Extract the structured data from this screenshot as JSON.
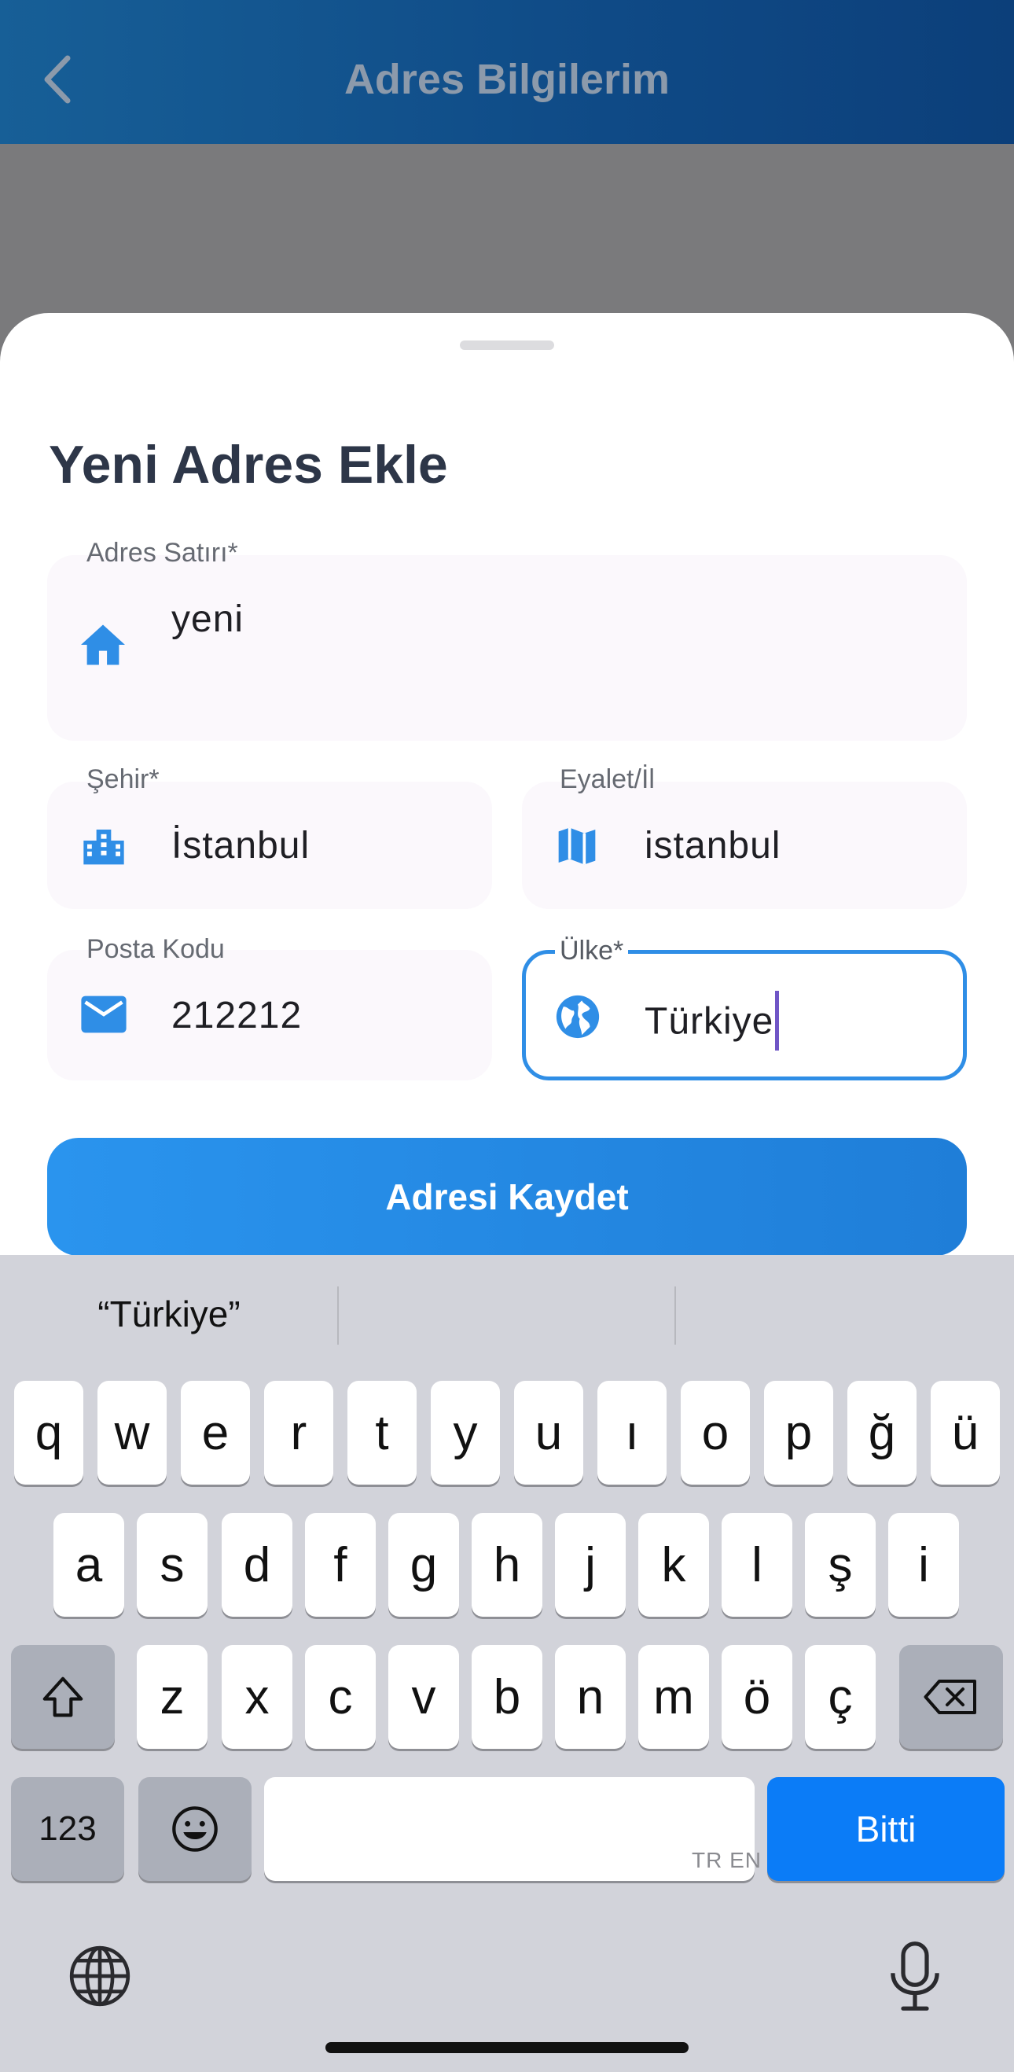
{
  "header": {
    "title": "Adres Bilgilerim",
    "back_icon": "chevron-left-icon"
  },
  "sheet": {
    "title": "Yeni Adres Ekle"
  },
  "form": {
    "address": {
      "label": "Adres Satırı*",
      "value": "yeni",
      "icon": "home-icon"
    },
    "city": {
      "label": "Şehir*",
      "value": "İstanbul",
      "icon": "city-icon"
    },
    "state": {
      "label": "Eyalet/İl",
      "value": "istanbul",
      "icon": "map-icon"
    },
    "postal": {
      "label": "Posta Kodu",
      "value": "212212",
      "icon": "mail-icon"
    },
    "country": {
      "label": "Ülke*",
      "value": "Türkiye",
      "icon": "globe-icon",
      "focused": true
    }
  },
  "save_button": {
    "label": "Adresi Kaydet"
  },
  "keyboard": {
    "suggestions": [
      "“Türkiye”",
      "",
      ""
    ],
    "row1": [
      "q",
      "w",
      "e",
      "r",
      "t",
      "y",
      "u",
      "ı",
      "o",
      "p",
      "ğ",
      "ü"
    ],
    "row2": [
      "a",
      "s",
      "d",
      "f",
      "g",
      "h",
      "j",
      "k",
      "l",
      "ş",
      "i"
    ],
    "row3": [
      "z",
      "x",
      "c",
      "v",
      "b",
      "n",
      "m",
      "ö",
      "ç"
    ],
    "numbers_label": "123",
    "done_label": "Bitti",
    "language_hint": "TR EN",
    "colors": {
      "accent": "#0b7cf7",
      "background": "#d2d3da"
    }
  },
  "colors": {
    "brand": "#175f97",
    "primary": "#2a94ee",
    "field_bg": "#fbf8fc",
    "focus_border": "#2f8ee6"
  }
}
